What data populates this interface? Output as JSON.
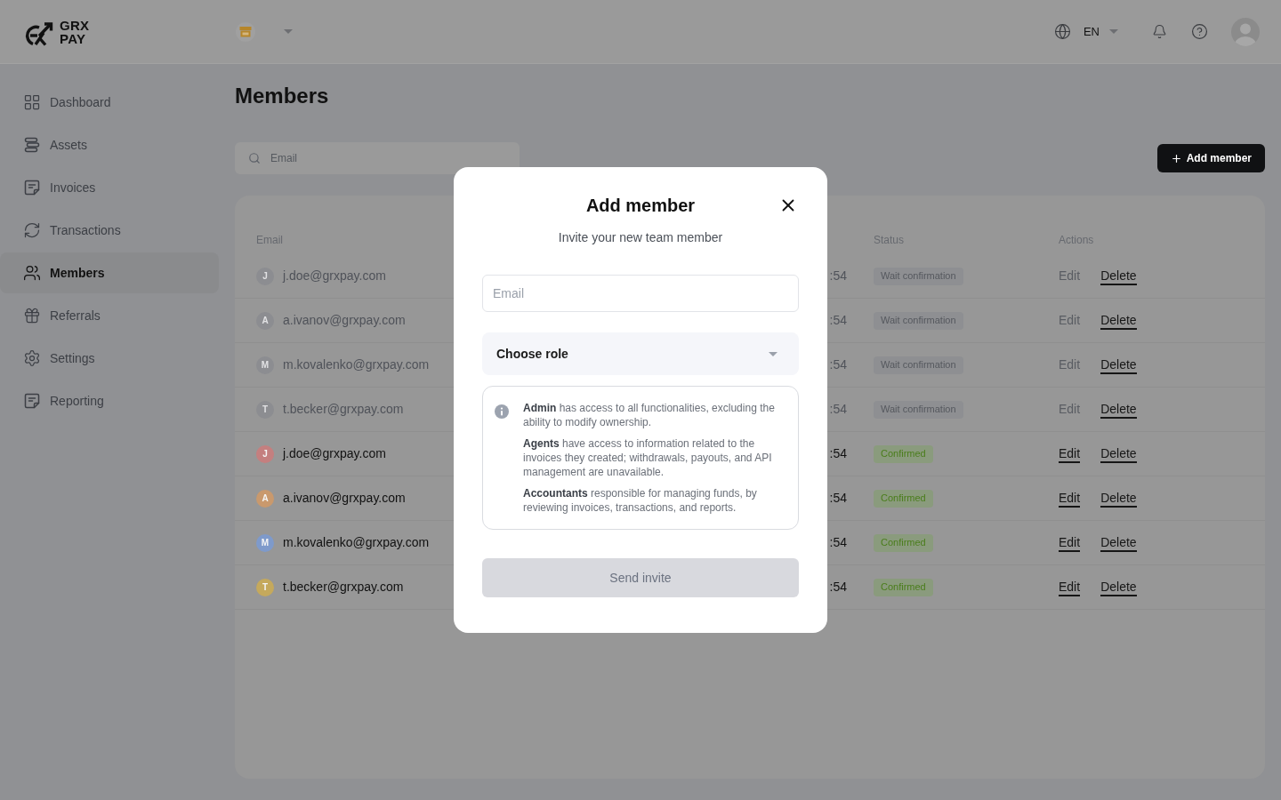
{
  "header": {
    "logo": {
      "line_1": "GRX",
      "line_2": "PAY"
    },
    "language": "EN"
  },
  "sidebar": {
    "items": [
      {
        "label": "Dashboard",
        "selected": false
      },
      {
        "label": "Assets",
        "selected": false
      },
      {
        "label": "Invoices",
        "selected": false
      },
      {
        "label": "Transactions",
        "selected": false
      },
      {
        "label": "Members",
        "selected": true
      },
      {
        "label": "Referrals",
        "selected": false
      },
      {
        "label": "Settings",
        "selected": false
      },
      {
        "label": "Reporting",
        "selected": false
      }
    ]
  },
  "page": {
    "title": "Members",
    "search": {
      "placeholder": "Email"
    },
    "add_button": {
      "label": "Add member"
    }
  },
  "table": {
    "columns": [
      "Email",
      "Status",
      "Actions"
    ],
    "rows": [
      {
        "initial": "J",
        "color": "#8c8d91",
        "email": "j.doe@grxpay.com",
        "time": ":54",
        "status": {
          "kind": "pending",
          "label": "Wait confirmation"
        },
        "actions": [
          {
            "label": "Edit",
            "disabled": true
          },
          {
            "label": "Delete",
            "disabled": false
          }
        ]
      },
      {
        "initial": "A",
        "color": "#8c8d91",
        "email": "a.ivanov@grxpay.com",
        "time": ":54",
        "status": {
          "kind": "pending",
          "label": "Wait confirmation"
        },
        "actions": [
          {
            "label": "Edit",
            "disabled": true
          },
          {
            "label": "Delete",
            "disabled": false
          }
        ]
      },
      {
        "initial": "M",
        "color": "#8c8d91",
        "email": "m.kovalenko@grxpay.com",
        "time": ":54",
        "status": {
          "kind": "pending",
          "label": "Wait confirmation"
        },
        "actions": [
          {
            "label": "Edit",
            "disabled": true
          },
          {
            "label": "Delete",
            "disabled": false
          }
        ]
      },
      {
        "initial": "T",
        "color": "#8c8d91",
        "email": "t.becker@grxpay.com",
        "time": ":54",
        "status": {
          "kind": "pending",
          "label": "Wait confirmation"
        },
        "actions": [
          {
            "label": "Edit",
            "disabled": true
          },
          {
            "label": "Delete",
            "disabled": false
          }
        ]
      },
      {
        "initial": "J",
        "color": "#c47f7f",
        "email": "j.doe@grxpay.com",
        "time": ":54",
        "status": {
          "kind": "confirmed",
          "label": "Confirmed"
        },
        "actions": [
          {
            "label": "Edit",
            "disabled": false
          },
          {
            "label": "Delete",
            "disabled": false
          }
        ]
      },
      {
        "initial": "A",
        "color": "#c9996d",
        "email": "a.ivanov@grxpay.com",
        "time": ":54",
        "status": {
          "kind": "confirmed",
          "label": "Confirmed"
        },
        "actions": [
          {
            "label": "Edit",
            "disabled": false
          },
          {
            "label": "Delete",
            "disabled": false
          }
        ]
      },
      {
        "initial": "M",
        "color": "#7e9acb",
        "email": "m.kovalenko@grxpay.com",
        "time": ":54",
        "status": {
          "kind": "confirmed",
          "label": "Confirmed"
        },
        "actions": [
          {
            "label": "Edit",
            "disabled": false
          },
          {
            "label": "Delete",
            "disabled": false
          }
        ]
      },
      {
        "initial": "T",
        "color": "#c5a95c",
        "email": "t.becker@grxpay.com",
        "time": ":54",
        "status": {
          "kind": "confirmed",
          "label": "Confirmed"
        },
        "actions": [
          {
            "label": "Edit",
            "disabled": false
          },
          {
            "label": "Delete",
            "disabled": false
          }
        ]
      }
    ]
  },
  "modal": {
    "title": "Add member",
    "subtitle": "Invite your new team member",
    "email": {
      "placeholder": "Email"
    },
    "role": {
      "label": "Choose role"
    },
    "info": [
      "**Admin** has access to all functionalities, excluding the ability to modify ownership.",
      "**Agents** have access to information related to the invoices they created; withdrawals, payouts, and API management are unavailable.",
      "**Accountants** responsible for managing funds, by reviewing invoices, transactions, and reports."
    ],
    "submit": {
      "label": "Send invite",
      "disabled": true
    }
  }
}
